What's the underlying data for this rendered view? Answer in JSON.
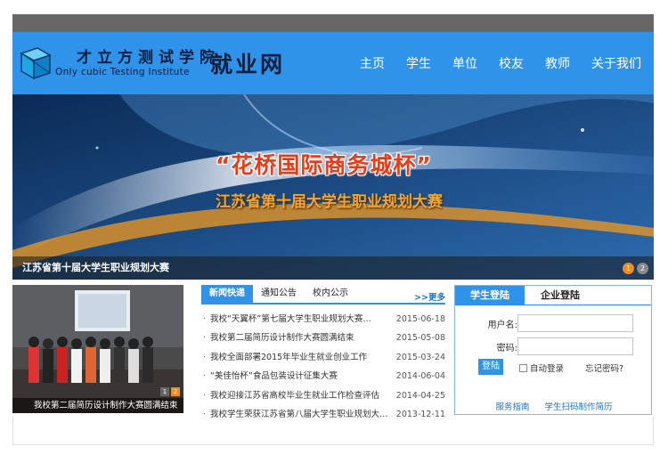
{
  "header": {
    "school_name_cn": "才立方测试学院",
    "school_name_en": "Only cubic Testing Institute",
    "site_name": "就业网",
    "nav": [
      {
        "label": "主页"
      },
      {
        "label": "学生"
      },
      {
        "label": "单位"
      },
      {
        "label": "校友"
      },
      {
        "label": "教师"
      },
      {
        "label": "关于我们"
      }
    ]
  },
  "banner": {
    "headline": "“花桥国际商务城杯”",
    "subline": "江苏省第十届大学生职业规划大赛",
    "caption": "江苏省第十届大学生职业规划大赛",
    "dots": [
      "1",
      "2"
    ],
    "active_dot": 0
  },
  "photo": {
    "caption": "我校第二届简历设计制作大赛圆满结束",
    "pages": [
      "1",
      "2"
    ]
  },
  "news": {
    "tabs": [
      "新闻快递",
      "通知公告",
      "校内公示"
    ],
    "more_label": "更多",
    "items": [
      {
        "title": "我校“天翼杯”第七届大学生职业规划大赛…",
        "date": "2015-06-18"
      },
      {
        "title": "我校第二届简历设计制作大赛圆满结束",
        "date": "2015-05-08"
      },
      {
        "title": "我校全面部署2015年毕业生就业创业工作",
        "date": "2015-03-24"
      },
      {
        "title": "“美佳怡杯”食品包装设计征集大赛",
        "date": "2014-06-04"
      },
      {
        "title": "我校迎接江苏省高校毕业生就业工作检查评估",
        "date": "2014-04-25"
      },
      {
        "title": "我校学生荣获江苏省第八届大学生职业规划大…",
        "date": "2013-12-11"
      }
    ]
  },
  "login": {
    "tabs": [
      "学生登陆",
      "企业登陆"
    ],
    "username_label": "用户名:",
    "password_label": "密码:",
    "submit_label": "登陆",
    "auto_login_label": "自动登录",
    "forgot_label": "忘记密码?",
    "links": [
      "服务指南",
      "学生扫码制作简历"
    ]
  },
  "colors": {
    "brand_blue": "#2f93ea",
    "top_strip": "#676767",
    "headline_red": "#e93b16",
    "subline_orange": "#f6a72a",
    "active_dot": "#f08a24"
  }
}
